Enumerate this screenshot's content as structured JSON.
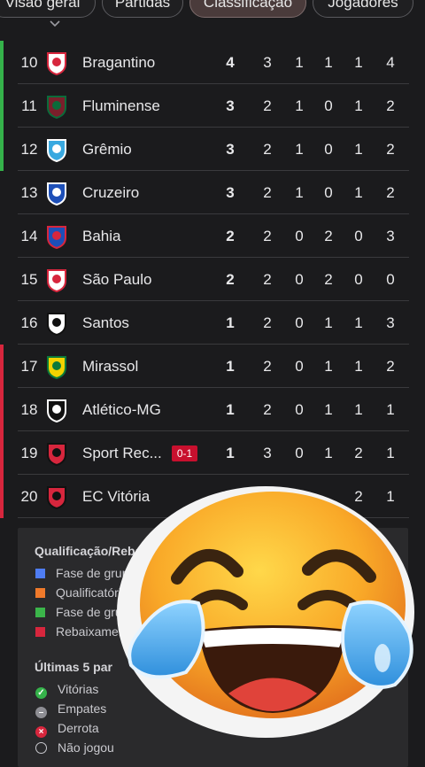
{
  "tabs": [
    {
      "label": "Visão geral"
    },
    {
      "label": "Partidas"
    },
    {
      "label": "Classificação"
    },
    {
      "label": "Jogadores"
    }
  ],
  "rows": [
    {
      "pos": "10",
      "team": "Bragantino",
      "badge": "",
      "zone": "#35b24a",
      "stats": [
        "4",
        "3",
        "1",
        "1",
        "1",
        "4"
      ]
    },
    {
      "pos": "11",
      "team": "Fluminense",
      "badge": "",
      "zone": "#35b24a",
      "stats": [
        "3",
        "2",
        "1",
        "0",
        "1",
        "2"
      ]
    },
    {
      "pos": "12",
      "team": "Grêmio",
      "badge": "",
      "zone": "#35b24a",
      "stats": [
        "3",
        "2",
        "1",
        "0",
        "1",
        "2"
      ]
    },
    {
      "pos": "13",
      "team": "Cruzeiro",
      "badge": "",
      "zone": "",
      "stats": [
        "3",
        "2",
        "1",
        "0",
        "1",
        "2"
      ]
    },
    {
      "pos": "14",
      "team": "Bahia",
      "badge": "",
      "zone": "",
      "stats": [
        "2",
        "2",
        "0",
        "2",
        "0",
        "3"
      ]
    },
    {
      "pos": "15",
      "team": "São Paulo",
      "badge": "",
      "zone": "",
      "stats": [
        "2",
        "2",
        "0",
        "2",
        "0",
        "0"
      ]
    },
    {
      "pos": "16",
      "team": "Santos",
      "badge": "",
      "zone": "",
      "stats": [
        "1",
        "2",
        "0",
        "1",
        "1",
        "3"
      ]
    },
    {
      "pos": "17",
      "team": "Mirassol",
      "badge": "",
      "zone": "#d7263d",
      "stats": [
        "1",
        "2",
        "0",
        "1",
        "1",
        "2"
      ]
    },
    {
      "pos": "18",
      "team": "Atlético-MG",
      "badge": "",
      "zone": "#d7263d",
      "stats": [
        "1",
        "2",
        "0",
        "1",
        "1",
        "1"
      ]
    },
    {
      "pos": "19",
      "team": "Sport Rec...",
      "badge": "0-1",
      "zone": "#d7263d",
      "stats": [
        "1",
        "3",
        "0",
        "1",
        "2",
        "1"
      ]
    },
    {
      "pos": "20",
      "team": "EC Vitória",
      "badge": "",
      "zone": "#d7263d",
      "stats": [
        "",
        "",
        "",
        "",
        "2",
        "1"
      ]
    }
  ],
  "legend": {
    "title1": "Qualificação/Rebai",
    "items1": [
      {
        "label": "Fase de grup",
        "color": "#4f7df3"
      },
      {
        "label": "Qualificatóri",
        "color": "#f07a2b"
      },
      {
        "label": "Fase de grup",
        "color": "#3bb54a"
      },
      {
        "label": "Rebaixamen",
        "color": "#d7263d"
      }
    ],
    "title2": "Últimas 5 par",
    "items2": [
      {
        "label": "Vitórias",
        "icon": "check-icon"
      },
      {
        "label": "Empates",
        "icon": "minus-icon"
      },
      {
        "label": "Derrota",
        "icon": "x-icon"
      },
      {
        "label": "Não jogou",
        "icon": "empty-circle-icon"
      }
    ]
  },
  "overlay": {
    "icon": "laughing-crying-emoji-icon"
  }
}
